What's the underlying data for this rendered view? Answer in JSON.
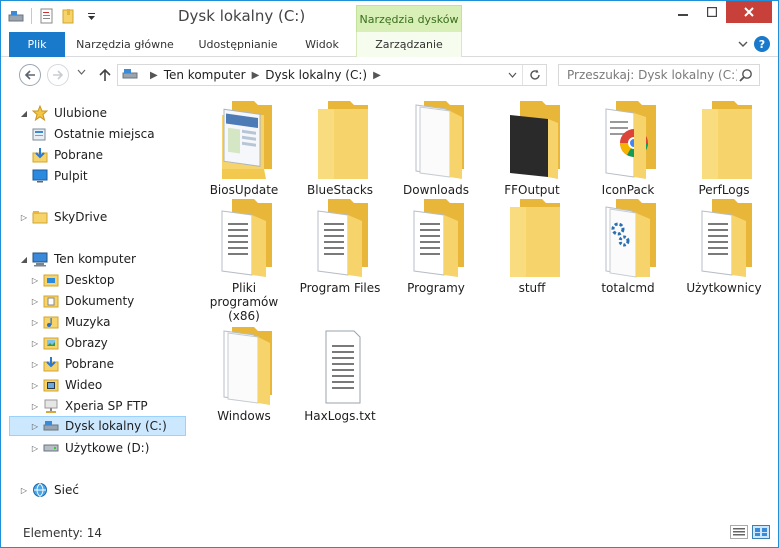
{
  "window": {
    "title": "Dysk lokalny (C:)",
    "context_group": "Narzędzia dysków"
  },
  "ribbon": {
    "tabs": [
      "Plik",
      "Narzędzia główne",
      "Udostępnianie",
      "Widok",
      "Zarządzanie"
    ]
  },
  "address": {
    "crumbs": [
      "Ten komputer",
      "Dysk lokalny (C:)"
    ],
    "search_placeholder": "Przeszukaj: Dysk lokalny (C:)"
  },
  "nav": {
    "favorites": "Ulubione",
    "recent": "Ostatnie miejsca",
    "downloads_fav": "Pobrane",
    "desktop_fav": "Pulpit",
    "skydrive": "SkyDrive",
    "computer": "Ten komputer",
    "desktop": "Desktop",
    "documents": "Dokumenty",
    "music": "Muzyka",
    "pictures": "Obrazy",
    "downloads": "Pobrane",
    "videos": "Wideo",
    "xperia": "Xperia SP FTP",
    "local_disk": "Dysk lokalny (C:)",
    "utility_drive": "Użytkowe (D:)",
    "network": "Sieć"
  },
  "files": [
    {
      "name": "BiosUpdate",
      "kind": "folder-doc"
    },
    {
      "name": "BlueStacks",
      "kind": "folder-empty"
    },
    {
      "name": "Downloads",
      "kind": "folder-paper"
    },
    {
      "name": "FFOutput",
      "kind": "folder-dark"
    },
    {
      "name": "IconPack",
      "kind": "folder-chrome"
    },
    {
      "name": "PerfLogs",
      "kind": "folder-empty"
    },
    {
      "name": "Pliki programów (x86)",
      "kind": "folder-lines"
    },
    {
      "name": "Program Files",
      "kind": "folder-lines"
    },
    {
      "name": "Programy",
      "kind": "folder-lines"
    },
    {
      "name": "stuff",
      "kind": "folder-empty"
    },
    {
      "name": "totalcmd",
      "kind": "folder-gear"
    },
    {
      "name": "Użytkownicy",
      "kind": "folder-lines"
    },
    {
      "name": "Windows",
      "kind": "folder-paper"
    },
    {
      "name": "HaxLogs.txt",
      "kind": "text-file"
    }
  ],
  "status": {
    "count": "Elementy: 14"
  },
  "colors": {
    "accent": "#1979ca",
    "folder": "#f6d46b",
    "folder_back": "#e8b73a",
    "context_tab": "#d8f0b7",
    "selection": "#cce8ff"
  }
}
